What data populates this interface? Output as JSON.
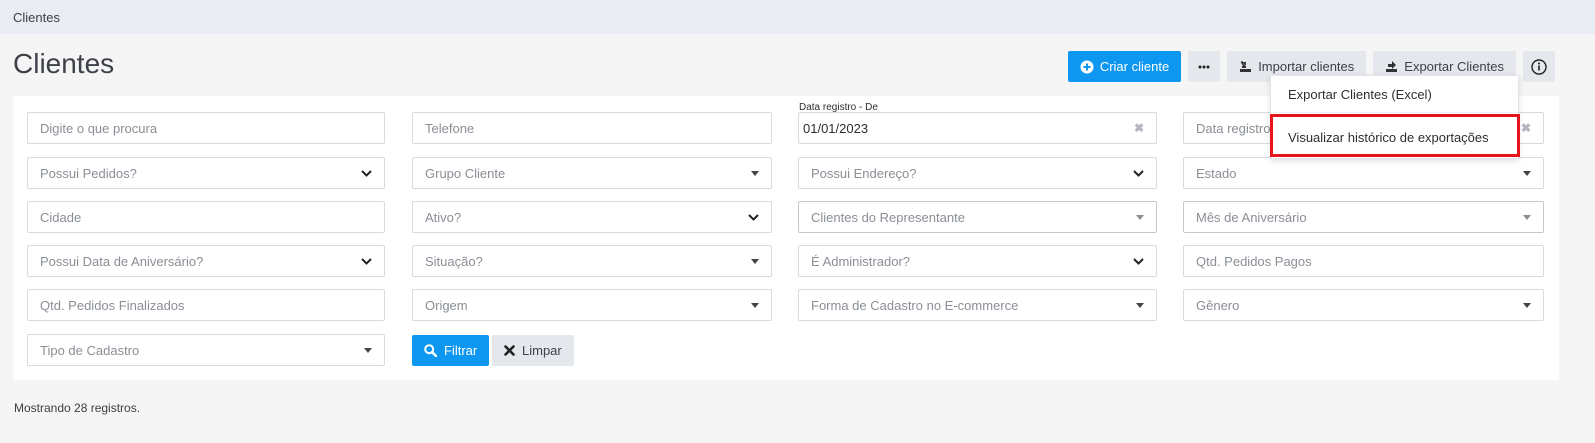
{
  "breadcrumb": {
    "current": "Clientes"
  },
  "page": {
    "title": "Clientes"
  },
  "toolbar": {
    "create_label": "Criar cliente",
    "import_label": "Importar clientes",
    "export_label": "Exportar Clientes"
  },
  "filters": {
    "search": "Digite o que procura",
    "phone": "Telefone",
    "date_from_label": "Data registro - De",
    "date_from_value": "01/01/2023",
    "date_to_placeholder": "Data registro",
    "has_orders": "Possui Pedidos?",
    "client_group": "Grupo Cliente",
    "has_address": "Possui Endereço?",
    "state": "Estado",
    "city": "Cidade",
    "active": "Ativo?",
    "rep_clients": "Clientes do Representante",
    "birth_month": "Mês de Aniversário",
    "has_birthday": "Possui Data de Aniversário?",
    "situation": "Situação?",
    "is_admin": "É Administrador?",
    "paid_orders_qty": "Qtd. Pedidos Pagos",
    "finished_orders_qty": "Qtd. Pedidos Finalizados",
    "origin": "Origem",
    "ecommerce_signup": "Forma de Cadastro no E-commerce",
    "gender": "Gênero",
    "signup_type": "Tipo de Cadastro"
  },
  "actions": {
    "filter_label": "Filtrar",
    "clear_label": "Limpar"
  },
  "status": {
    "records_text": "Mostrando 28 registros."
  },
  "export_menu": {
    "items": [
      "Exportar Clientes (Excel)",
      "Visualizar histórico de exportações"
    ]
  },
  "colors": {
    "primary": "#0d97f1",
    "highlight": "#e8141b"
  }
}
